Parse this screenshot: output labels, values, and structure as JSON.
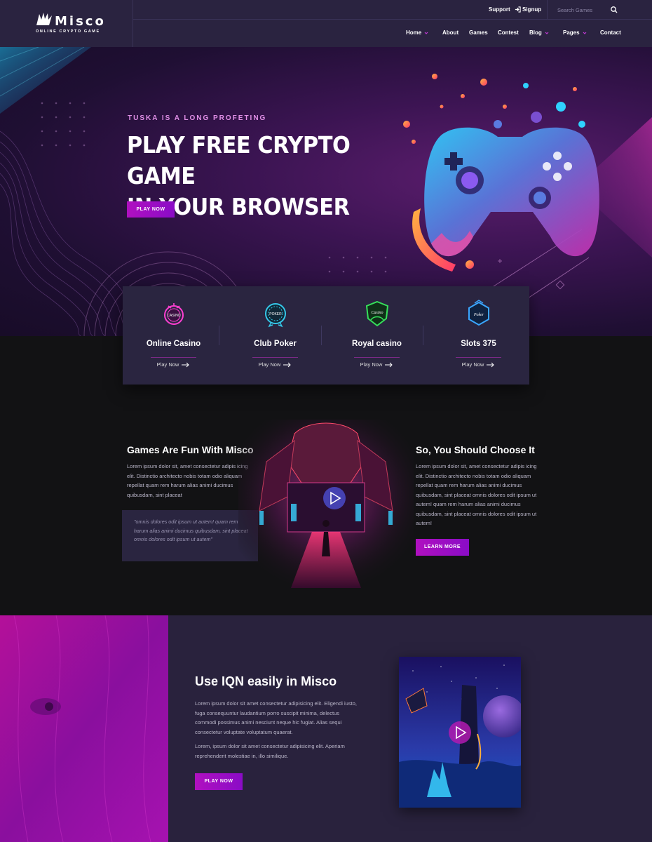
{
  "brand": {
    "name": "Misco",
    "tagline": "ONLINE CRYPTO GAME"
  },
  "topbar": {
    "support": "Support",
    "signup": "Signup",
    "search_placeholder": "Search Games"
  },
  "nav": {
    "items": [
      {
        "label": "Home",
        "dropdown": true
      },
      {
        "label": "About",
        "dropdown": false
      },
      {
        "label": "Games",
        "dropdown": false
      },
      {
        "label": "Contest",
        "dropdown": false
      },
      {
        "label": "Blog",
        "dropdown": true
      },
      {
        "label": "Pages",
        "dropdown": true
      },
      {
        "label": "Contact",
        "dropdown": false
      }
    ]
  },
  "hero": {
    "subtitle": "TUSKA IS A LONG PROFETING",
    "title_line1": "PLAY FREE CRYPTO GAME",
    "title_line2": "IN YOUR BROWSER",
    "cta": "PLAY NOW"
  },
  "features": [
    {
      "name": "Online Casino",
      "link": "Play Now",
      "badge": "CASINO",
      "icon": "casino-icon",
      "color": "#ff3fd2"
    },
    {
      "name": "Club Poker",
      "link": "Play Now",
      "badge": "POKER",
      "icon": "club-poker-icon",
      "color": "#35c7e8"
    },
    {
      "name": "Royal casino",
      "link": "Play Now",
      "badge": "Casino",
      "icon": "royal-casino-icon",
      "color": "#36e05a"
    },
    {
      "name": "Slots 375",
      "link": "Play Now",
      "badge": "Poker",
      "icon": "slots-icon",
      "color": "#3aa6ff"
    }
  ],
  "info": {
    "left_title": "Games Are Fun With Misco",
    "left_text": "Lorem ipsum dolor sit, amet consectetur adipis icing elit. Distinctio architecto nobis totam odio aliquam repellat quam rem harum alias animi ducimus quibusdam, sint placeat",
    "quote": "\"omnis dolores odit ipsum ut autem! quam rem harum alias animi ducimus quibusdam, sint placeat omnis dolores odit ipsum ut autem\"",
    "right_title": "So, You Should Choose It",
    "right_text": "Lorem ipsum dolor sit, amet consectetur adipis icing elit. Distinctio architecto nobis totam odio aliquam repellat quam rem harum alias animi ducimus quibusdam, sint placeat omnis dolores odit ipsum ut autem! quam rem harum alias animi ducimus quibusdam, sint placeat omnis dolores odit ipsum ut autem!",
    "cta": "LEARN MORE"
  },
  "bottom": {
    "title": "Use IQN easily in Misco",
    "para1": "Lorem ipsum dolor sit amet consectetur adipisicing elit. Eligendi iusto, fuga consequuntur laudantium porro suscipit minima, delectus commodi possimus animi nesciunt neque hic fugiat. Alias sequi consectetur voluptate voluptatum quaerat.",
    "para2": "Lorem, ipsum dolor sit amet consectetur adipisicing elit. Aperiam reprehenderit molestiae in, illo similique.",
    "cta": "PLAY NOW"
  },
  "colors": {
    "header_bg": "#2a2340",
    "accent": "#b010c0",
    "accent_soft": "#e08fe6",
    "page_bg": "#121214",
    "card_bg": "#2a2540"
  }
}
